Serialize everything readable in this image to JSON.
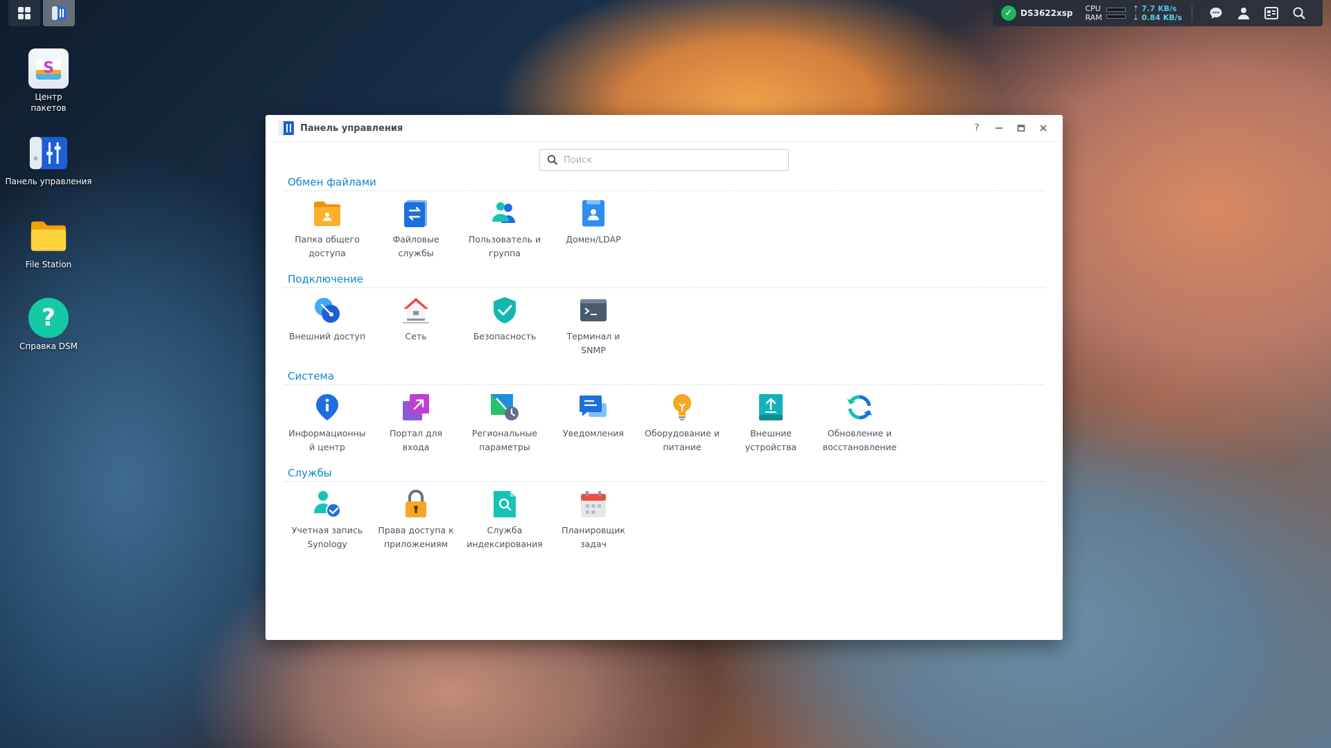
{
  "taskbar": {
    "server_name": "DS3622xsp",
    "cpu_label": "CPU",
    "ram_label": "RAM",
    "upload": "7.7 KB/s",
    "download": "0.84 KB/s"
  },
  "desktop": {
    "items": [
      {
        "label_line1": "Центр",
        "label_line2": "пакетов"
      },
      {
        "label_line1": "Панель управления",
        "label_line2": ""
      },
      {
        "label_line1": "File Station",
        "label_line2": ""
      },
      {
        "label_line1": "Справка DSM",
        "label_line2": ""
      }
    ]
  },
  "window": {
    "title": "Панель управления",
    "search_placeholder": "Поиск",
    "help_glyph": "?",
    "sections": [
      {
        "title": "Обмен файлами",
        "items": [
          {
            "line1": "Папка общего",
            "line2": "доступа",
            "icon": "shared-folder-icon"
          },
          {
            "line1": "Файловые",
            "line2": "службы",
            "icon": "file-services-icon"
          },
          {
            "line1": "Пользователь и",
            "line2": "группа",
            "icon": "users-icon"
          },
          {
            "line1": "Домен/LDAP",
            "line2": "",
            "icon": "domain-icon"
          }
        ]
      },
      {
        "title": "Подключение",
        "items": [
          {
            "line1": "Внешний доступ",
            "line2": "",
            "icon": "external-access-icon"
          },
          {
            "line1": "Сеть",
            "line2": "",
            "icon": "network-house-icon"
          },
          {
            "line1": "Безопасность",
            "line2": "",
            "icon": "security-shield-icon"
          },
          {
            "line1": "Терминал и",
            "line2": "SNMP",
            "icon": "terminal-icon"
          }
        ]
      },
      {
        "title": "Система",
        "items": [
          {
            "line1": "Информационны",
            "line2": "й центр",
            "icon": "info-pin-icon"
          },
          {
            "line1": "Портал для",
            "line2": "входа",
            "icon": "login-portal-icon"
          },
          {
            "line1": "Региональные",
            "line2": "параметры",
            "icon": "regional-map-icon"
          },
          {
            "line1": "Уведомления",
            "line2": "",
            "icon": "notification-icon"
          },
          {
            "line1": "Оборудование и",
            "line2": "питание",
            "icon": "lightbulb-icon"
          },
          {
            "line1": "Внешние",
            "line2": "устройства",
            "icon": "external-device-icon"
          },
          {
            "line1": "Обновление и",
            "line2": "восстановление",
            "icon": "update-icon"
          }
        ]
      },
      {
        "title": "Службы",
        "items": [
          {
            "line1": "Учетная запись",
            "line2": "Synology",
            "icon": "synology-account-icon"
          },
          {
            "line1": "Права доступа к",
            "line2": "приложениям",
            "icon": "app-privileges-lock-icon"
          },
          {
            "line1": "Служба",
            "line2": "индексирования",
            "icon": "indexing-search-icon"
          },
          {
            "line1": "Планировщик",
            "line2": "задач",
            "icon": "task-scheduler-calendar-icon"
          }
        ]
      }
    ]
  }
}
